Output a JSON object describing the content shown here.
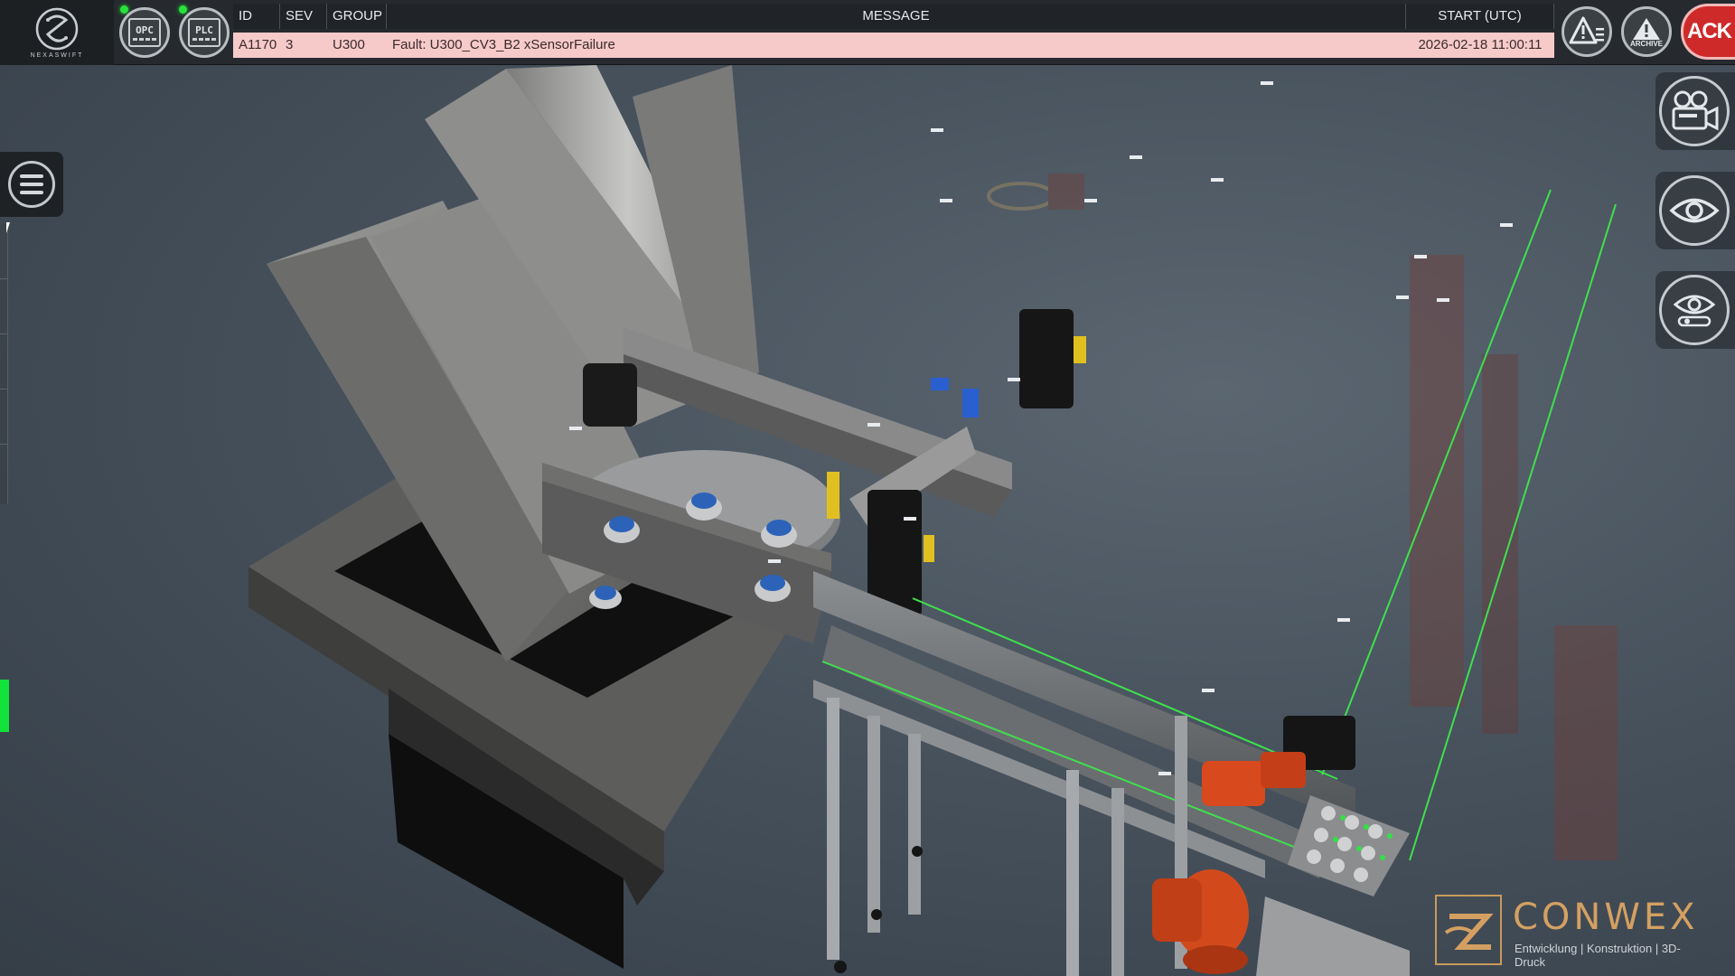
{
  "app": {
    "logo_text": "NEXASWIFT",
    "status_buttons": [
      {
        "label": "OPC",
        "status": "connected"
      },
      {
        "label": "PLC",
        "status": "connected"
      }
    ],
    "status_color": "#27e23a"
  },
  "alarms": {
    "columns": {
      "id": "ID",
      "sev": "SEV",
      "group": "GROUP",
      "message": "MESSAGE",
      "start": "START (UTC)"
    },
    "rows": [
      {
        "id": "A1170",
        "sev": "3",
        "group": "U300",
        "message": "Fault: U300_CV3_B2 xSensorFailure",
        "start": "2026-02-18 11:00:11"
      }
    ],
    "row_color": "#f7caca"
  },
  "toolbar_right": {
    "alarm_list_icon": "alarm-list-icon",
    "archive_label": "ARCHIVE",
    "ack_label": "ACK",
    "ack_color": "#cf2a2a"
  },
  "view_controls": [
    {
      "icon": "camera-icon"
    },
    {
      "icon": "eye-icon"
    },
    {
      "icon": "eye-settings-icon"
    }
  ],
  "brand": {
    "name": "CONWEX",
    "tagline": "Entwicklung | Konstruktion | 3D-Druck",
    "accent": "#d4a062"
  }
}
